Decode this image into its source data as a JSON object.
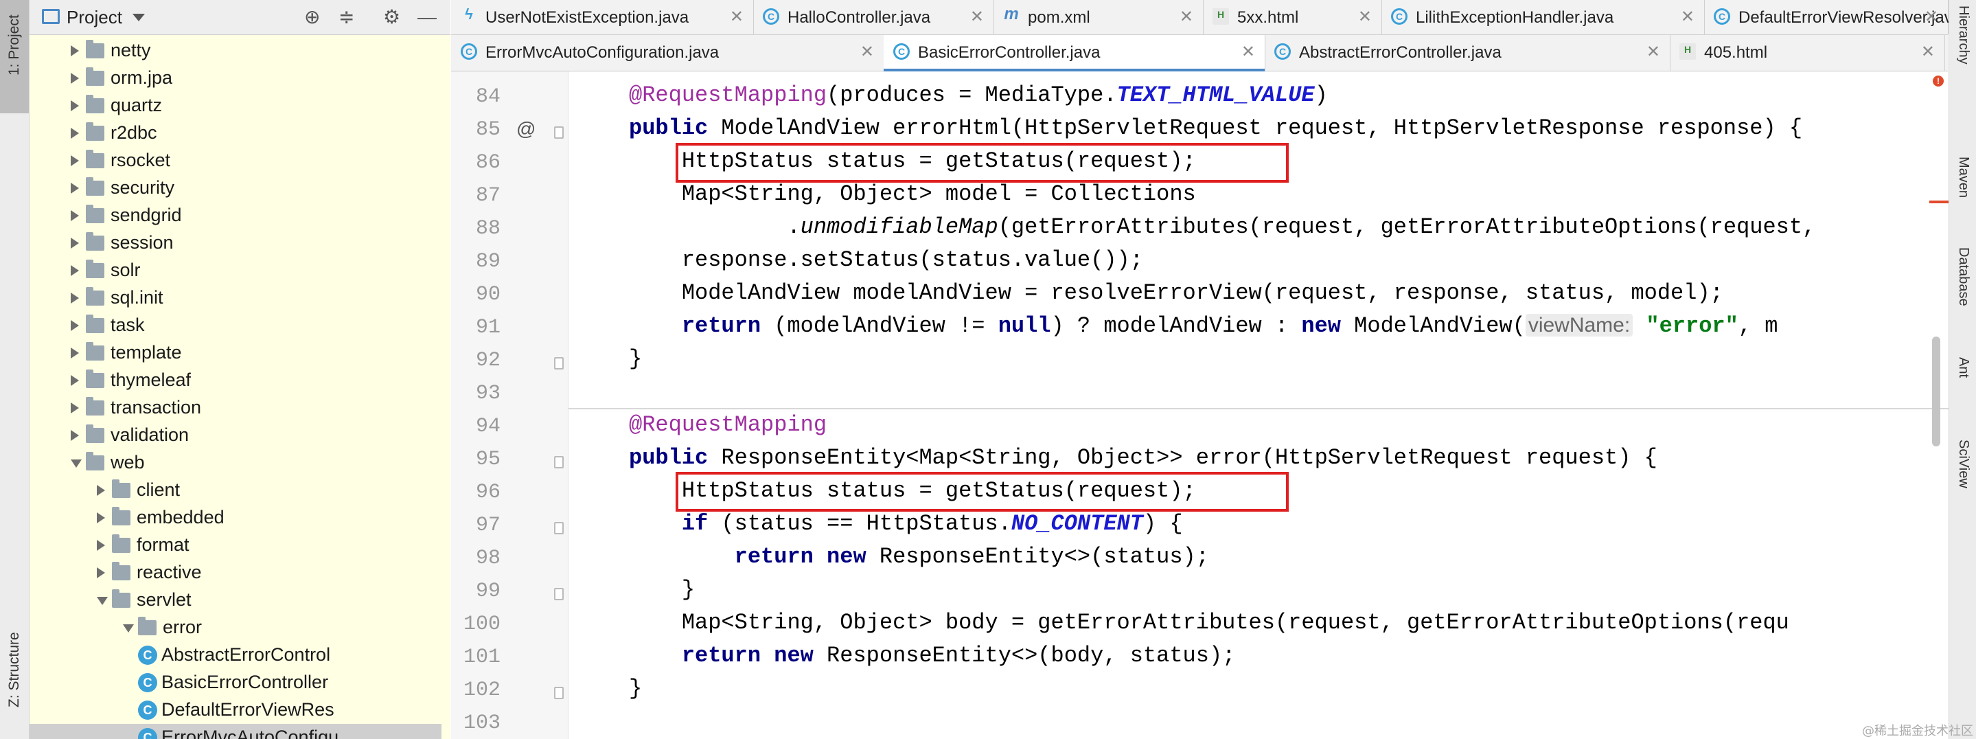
{
  "left_strip": {
    "project_label": "1: Project",
    "structure_label": "Z: Structure"
  },
  "right_strip": {
    "items": [
      "Hierarchy",
      "Maven",
      "Database",
      "Ant",
      "SciView"
    ]
  },
  "project_panel": {
    "title": "Project",
    "tree": [
      {
        "label": "netty",
        "kind": "folder",
        "level": 1,
        "expanded": false
      },
      {
        "label": "orm.jpa",
        "kind": "folder",
        "level": 1,
        "expanded": false
      },
      {
        "label": "quartz",
        "kind": "folder",
        "level": 1,
        "expanded": false
      },
      {
        "label": "r2dbc",
        "kind": "folder",
        "level": 1,
        "expanded": false
      },
      {
        "label": "rsocket",
        "kind": "folder",
        "level": 1,
        "expanded": false
      },
      {
        "label": "security",
        "kind": "folder",
        "level": 1,
        "expanded": false
      },
      {
        "label": "sendgrid",
        "kind": "folder",
        "level": 1,
        "expanded": false
      },
      {
        "label": "session",
        "kind": "folder",
        "level": 1,
        "expanded": false
      },
      {
        "label": "solr",
        "kind": "folder",
        "level": 1,
        "expanded": false
      },
      {
        "label": "sql.init",
        "kind": "folder",
        "level": 1,
        "expanded": false
      },
      {
        "label": "task",
        "kind": "folder",
        "level": 1,
        "expanded": false
      },
      {
        "label": "template",
        "kind": "folder",
        "level": 1,
        "expanded": false
      },
      {
        "label": "thymeleaf",
        "kind": "folder",
        "level": 1,
        "expanded": false
      },
      {
        "label": "transaction",
        "kind": "folder",
        "level": 1,
        "expanded": false
      },
      {
        "label": "validation",
        "kind": "folder",
        "level": 1,
        "expanded": false
      },
      {
        "label": "web",
        "kind": "folder",
        "level": 1,
        "expanded": true
      },
      {
        "label": "client",
        "kind": "folder",
        "level": 2,
        "expanded": false
      },
      {
        "label": "embedded",
        "kind": "folder",
        "level": 2,
        "expanded": false
      },
      {
        "label": "format",
        "kind": "folder",
        "level": 2,
        "expanded": false
      },
      {
        "label": "reactive",
        "kind": "folder",
        "level": 2,
        "expanded": false
      },
      {
        "label": "servlet",
        "kind": "folder",
        "level": 2,
        "expanded": true
      },
      {
        "label": "error",
        "kind": "folder",
        "level": 3,
        "expanded": true
      },
      {
        "label": "AbstractErrorControl",
        "kind": "class",
        "level": 4
      },
      {
        "label": "BasicErrorController",
        "kind": "class",
        "level": 4
      },
      {
        "label": "DefaultErrorViewRes",
        "kind": "class",
        "level": 4
      },
      {
        "label": "ErrorMvcAutoConfigu",
        "kind": "class",
        "level": 4,
        "selected": true
      }
    ]
  },
  "tabs_row1": [
    {
      "label": "UserNotExistException.java",
      "icon": "lightning-icon"
    },
    {
      "label": "HalloController.java",
      "icon": "class-icon"
    },
    {
      "label": "pom.xml",
      "icon": "maven-icon"
    },
    {
      "label": "5xx.html",
      "icon": "html-icon"
    },
    {
      "label": "LilithExceptionHandler.java",
      "icon": "class-icon"
    },
    {
      "label": "DefaultErrorViewResolver.java",
      "icon": "class-icon"
    }
  ],
  "tabs_row2": [
    {
      "label": "ErrorMvcAutoConfiguration.java",
      "icon": "class-icon"
    },
    {
      "label": "BasicErrorController.java",
      "icon": "class-icon",
      "active": true
    },
    {
      "label": "AbstractErrorController.java",
      "icon": "class-icon"
    },
    {
      "label": "405.html",
      "icon": "html-icon"
    }
  ],
  "code": {
    "line_numbers": [
      "84",
      "85",
      "86",
      "87",
      "88",
      "89",
      "90",
      "91",
      "92",
      "93",
      "94",
      "95",
      "96",
      "97",
      "98",
      "99",
      "100",
      "101",
      "102",
      "103"
    ],
    "lines": [
      "@RequestMapping(produces = MediaType.TEXT_HTML_VALUE)",
      "public ModelAndView errorHtml(HttpServletRequest request, HttpServletResponse response) {",
      "    HttpStatus status = getStatus(request);",
      "    Map<String, Object> model = Collections",
      "            .unmodifiableMap(getErrorAttributes(request, getErrorAttributeOptions(request,",
      "    response.setStatus(status.value());",
      "    ModelAndView modelAndView = resolveErrorView(request, response, status, model);",
      "    return (modelAndView != null) ? modelAndView : new ModelAndView( viewName: \"error\", m",
      "}",
      "",
      "@RequestMapping",
      "public ResponseEntity<Map<String, Object>> error(HttpServletRequest request) {",
      "    HttpStatus status = getStatus(request);",
      "    if (status == HttpStatus.NO_CONTENT) {",
      "        return new ResponseEntity<>(status);",
      "    }",
      "    Map<String, Object> body = getErrorAttributes(request, getErrorAttributeOptions(requ",
      "    return new ResponseEntity<>(body, status);",
      "}",
      ""
    ]
  },
  "watermark": "@稀土掘金技术社区"
}
